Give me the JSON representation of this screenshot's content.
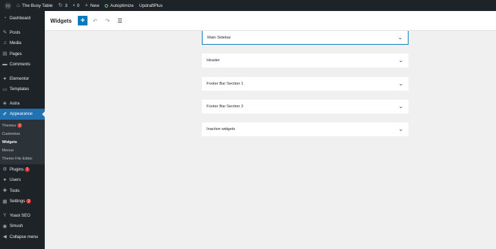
{
  "adminbar": {
    "site_name": "The Busy Table",
    "updates_count": "3",
    "comments_count": "0",
    "new_label": "New",
    "autoptimize_label": "Autoptimize",
    "updraft_label": "UpdraftPlus"
  },
  "sidebar": {
    "dashboard": "Dashboard",
    "posts": "Posts",
    "media": "Media",
    "pages": "Pages",
    "comments": "Comments",
    "elementor": "Elementor",
    "templates": "Templates",
    "astra": "Astra",
    "appearance": "Appearance",
    "sub": {
      "themes": "Themes",
      "themes_badge": "2",
      "customize": "Customize",
      "widgets": "Widgets",
      "menus": "Menus",
      "theme_file_editor": "Theme File Editor"
    },
    "plugins": "Plugins",
    "plugins_badge": "1",
    "users": "Users",
    "tools": "Tools",
    "settings": "Settings",
    "settings_badge": "2",
    "yoast": "Yoast SEO",
    "smush": "Smush",
    "collapse": "Collapse menu"
  },
  "header": {
    "title": "Widgets"
  },
  "widget_areas": [
    "Main Sidebar",
    "Header",
    "Footer Bar Section 1",
    "Footer Bar Section 2",
    "Inactive widgets"
  ],
  "colors": {
    "accent": "#007cba",
    "admin_dark": "#1d2327",
    "canvas": "#f0f0f0"
  }
}
